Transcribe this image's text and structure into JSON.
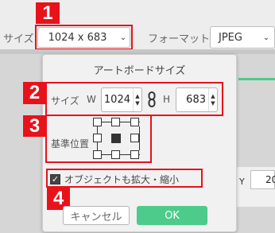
{
  "toolbar": {
    "size_label": "サイズ",
    "size_value": "1024 x 683",
    "format_label": "フォーマット",
    "format_value": "JPEG"
  },
  "popup": {
    "title": "アートボードサイズ",
    "size_label": "サイズ",
    "width_label": "W",
    "width_value": "1024",
    "height_label": "H",
    "height_value": "683",
    "anchor_label": "基準位置",
    "scale_objects_label": "オブジェクトも拡大・縮小",
    "scale_objects_checked": true,
    "cancel_label": "キャンセル",
    "ok_label": "OK"
  },
  "background": {
    "y_label": "Y",
    "y_value": "20"
  },
  "annotations": [
    "1",
    "2",
    "3",
    "4"
  ],
  "colors": {
    "annotation_red": "#e8121b",
    "ok_green": "#4ccb8a",
    "accent_green": "#4ccb8a"
  }
}
